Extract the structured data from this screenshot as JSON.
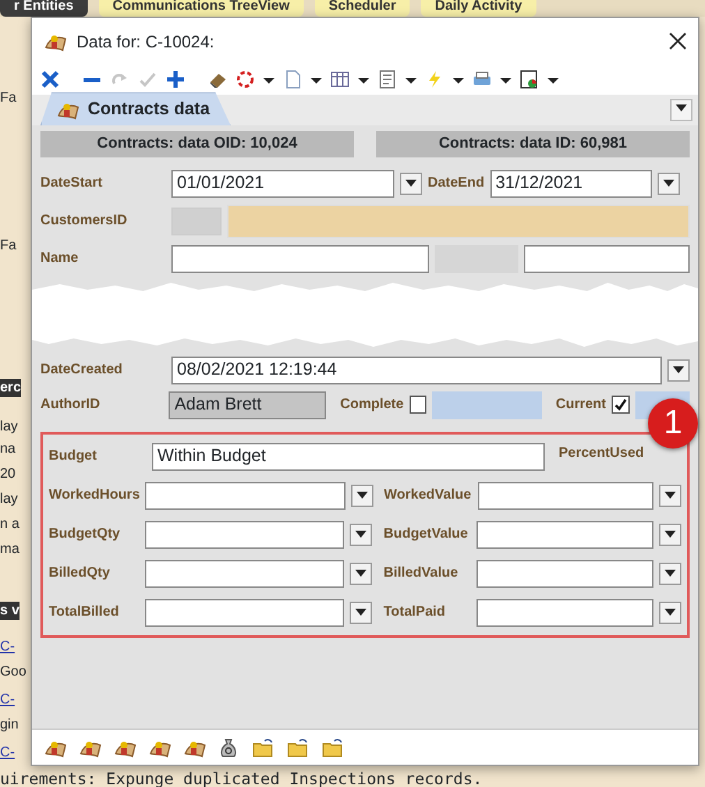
{
  "background": {
    "tabs": [
      {
        "label": "r Entities",
        "selected": true
      },
      {
        "label": "Communications TreeView",
        "selected": false
      },
      {
        "label": "Scheduler",
        "selected": false
      },
      {
        "label": "Daily Activity",
        "selected": false
      }
    ],
    "left_fragments": [
      {
        "kind": "text",
        "text": "Fa"
      },
      {
        "kind": "text",
        "text": "Fa"
      },
      {
        "kind": "heading",
        "text": "erc"
      },
      {
        "kind": "text",
        "text": "lay"
      },
      {
        "kind": "text",
        "text": "na"
      },
      {
        "kind": "text",
        "text": "20"
      },
      {
        "kind": "text",
        "text": "lay"
      },
      {
        "kind": "text",
        "text": "n a"
      },
      {
        "kind": "text",
        "text": "ma"
      },
      {
        "kind": "heading",
        "text": "s v"
      },
      {
        "kind": "link",
        "text": "C-"
      },
      {
        "kind": "text",
        "text": "Goo"
      },
      {
        "kind": "link",
        "text": "C-"
      },
      {
        "kind": "text",
        "text": "gin"
      },
      {
        "kind": "link",
        "text": "C-"
      }
    ],
    "status_text": "uirements: Expunge duplicated Inspections records."
  },
  "window": {
    "title": "Data for: C-10024:"
  },
  "toolbar": [
    {
      "kind": "cancel",
      "disabled": false,
      "dropdown": false
    },
    {
      "kind": "delete",
      "disabled": false,
      "dropdown": false
    },
    {
      "kind": "redo",
      "disabled": true,
      "dropdown": false
    },
    {
      "kind": "save",
      "disabled": true,
      "dropdown": false
    },
    {
      "kind": "add",
      "disabled": false,
      "dropdown": false
    },
    {
      "kind": "eraser",
      "disabled": false,
      "dropdown": false
    },
    {
      "kind": "refresh",
      "disabled": false,
      "dropdown": true
    },
    {
      "kind": "page",
      "disabled": false,
      "dropdown": true
    },
    {
      "kind": "grid",
      "disabled": false,
      "dropdown": true
    },
    {
      "kind": "document",
      "disabled": false,
      "dropdown": true
    },
    {
      "kind": "lightning",
      "disabled": false,
      "dropdown": true
    },
    {
      "kind": "printer",
      "disabled": false,
      "dropdown": true
    },
    {
      "kind": "chart",
      "disabled": false,
      "dropdown": true
    }
  ],
  "tab": {
    "label": "Contracts data",
    "selected": true
  },
  "headers": [
    "Contracts: data OID: 10,024",
    "Contracts: data ID: 60,981"
  ],
  "date_start": {
    "label": "DateStart",
    "value": "01/01/2021"
  },
  "date_end": {
    "label": "DateEnd",
    "value": "31/12/2021"
  },
  "customer": {
    "label": "CustomersID"
  },
  "name": {
    "label": "Name"
  },
  "date_created": {
    "label": "DateCreated",
    "value": "08/02/2021 12:19:44"
  },
  "author": {
    "label": "AuthorID",
    "value": "Adam Brett"
  },
  "flags": [
    {
      "label": "Complete",
      "checked": false
    },
    {
      "label": "Current",
      "checked": true
    }
  ],
  "budget": {
    "label": "Budget",
    "value": "Within Budget"
  },
  "percent_label": "PercentUsed",
  "amounts": [
    {
      "label": "WorkedHours"
    },
    {
      "label": "WorkedValue"
    },
    {
      "label": "BudgetQty"
    },
    {
      "label": "BudgetValue"
    },
    {
      "label": "BilledQty"
    },
    {
      "label": "BilledValue"
    },
    {
      "label": "TotalBilled"
    },
    {
      "label": "TotalPaid"
    }
  ],
  "callout": "1",
  "footer_icons": [
    {
      "kind": "record"
    },
    {
      "kind": "record"
    },
    {
      "kind": "record"
    },
    {
      "kind": "record"
    },
    {
      "kind": "record"
    },
    {
      "kind": "money"
    },
    {
      "kind": "folder"
    },
    {
      "kind": "folder"
    },
    {
      "kind": "folder"
    }
  ]
}
